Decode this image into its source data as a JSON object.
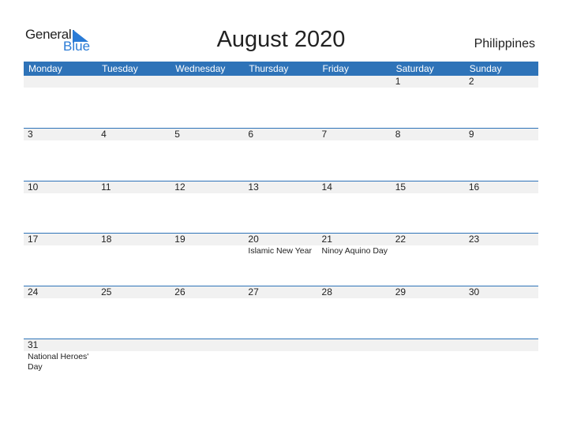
{
  "logo": {
    "general": "General",
    "blue": "Blue"
  },
  "title": "August 2020",
  "country": "Philippines",
  "colors": {
    "accent": "#2e73b8",
    "strip": "#f1f1f1",
    "logo_blue": "#2a7bd6"
  },
  "weekdays": [
    "Monday",
    "Tuesday",
    "Wednesday",
    "Thursday",
    "Friday",
    "Saturday",
    "Sunday"
  ],
  "weeks": [
    [
      {
        "d": ""
      },
      {
        "d": ""
      },
      {
        "d": ""
      },
      {
        "d": ""
      },
      {
        "d": ""
      },
      {
        "d": "1"
      },
      {
        "d": "2"
      }
    ],
    [
      {
        "d": "3"
      },
      {
        "d": "4"
      },
      {
        "d": "5"
      },
      {
        "d": "6"
      },
      {
        "d": "7"
      },
      {
        "d": "8"
      },
      {
        "d": "9"
      }
    ],
    [
      {
        "d": "10"
      },
      {
        "d": "11"
      },
      {
        "d": "12"
      },
      {
        "d": "13"
      },
      {
        "d": "14"
      },
      {
        "d": "15"
      },
      {
        "d": "16"
      }
    ],
    [
      {
        "d": "17"
      },
      {
        "d": "18"
      },
      {
        "d": "19"
      },
      {
        "d": "20",
        "h": "Islamic New Year"
      },
      {
        "d": "21",
        "h": "Ninoy Aquino Day"
      },
      {
        "d": "22"
      },
      {
        "d": "23"
      }
    ],
    [
      {
        "d": "24"
      },
      {
        "d": "25"
      },
      {
        "d": "26"
      },
      {
        "d": "27"
      },
      {
        "d": "28"
      },
      {
        "d": "29"
      },
      {
        "d": "30"
      }
    ],
    [
      {
        "d": "31",
        "h": "National Heroes' Day"
      },
      {
        "d": ""
      },
      {
        "d": ""
      },
      {
        "d": ""
      },
      {
        "d": ""
      },
      {
        "d": ""
      },
      {
        "d": ""
      }
    ]
  ]
}
